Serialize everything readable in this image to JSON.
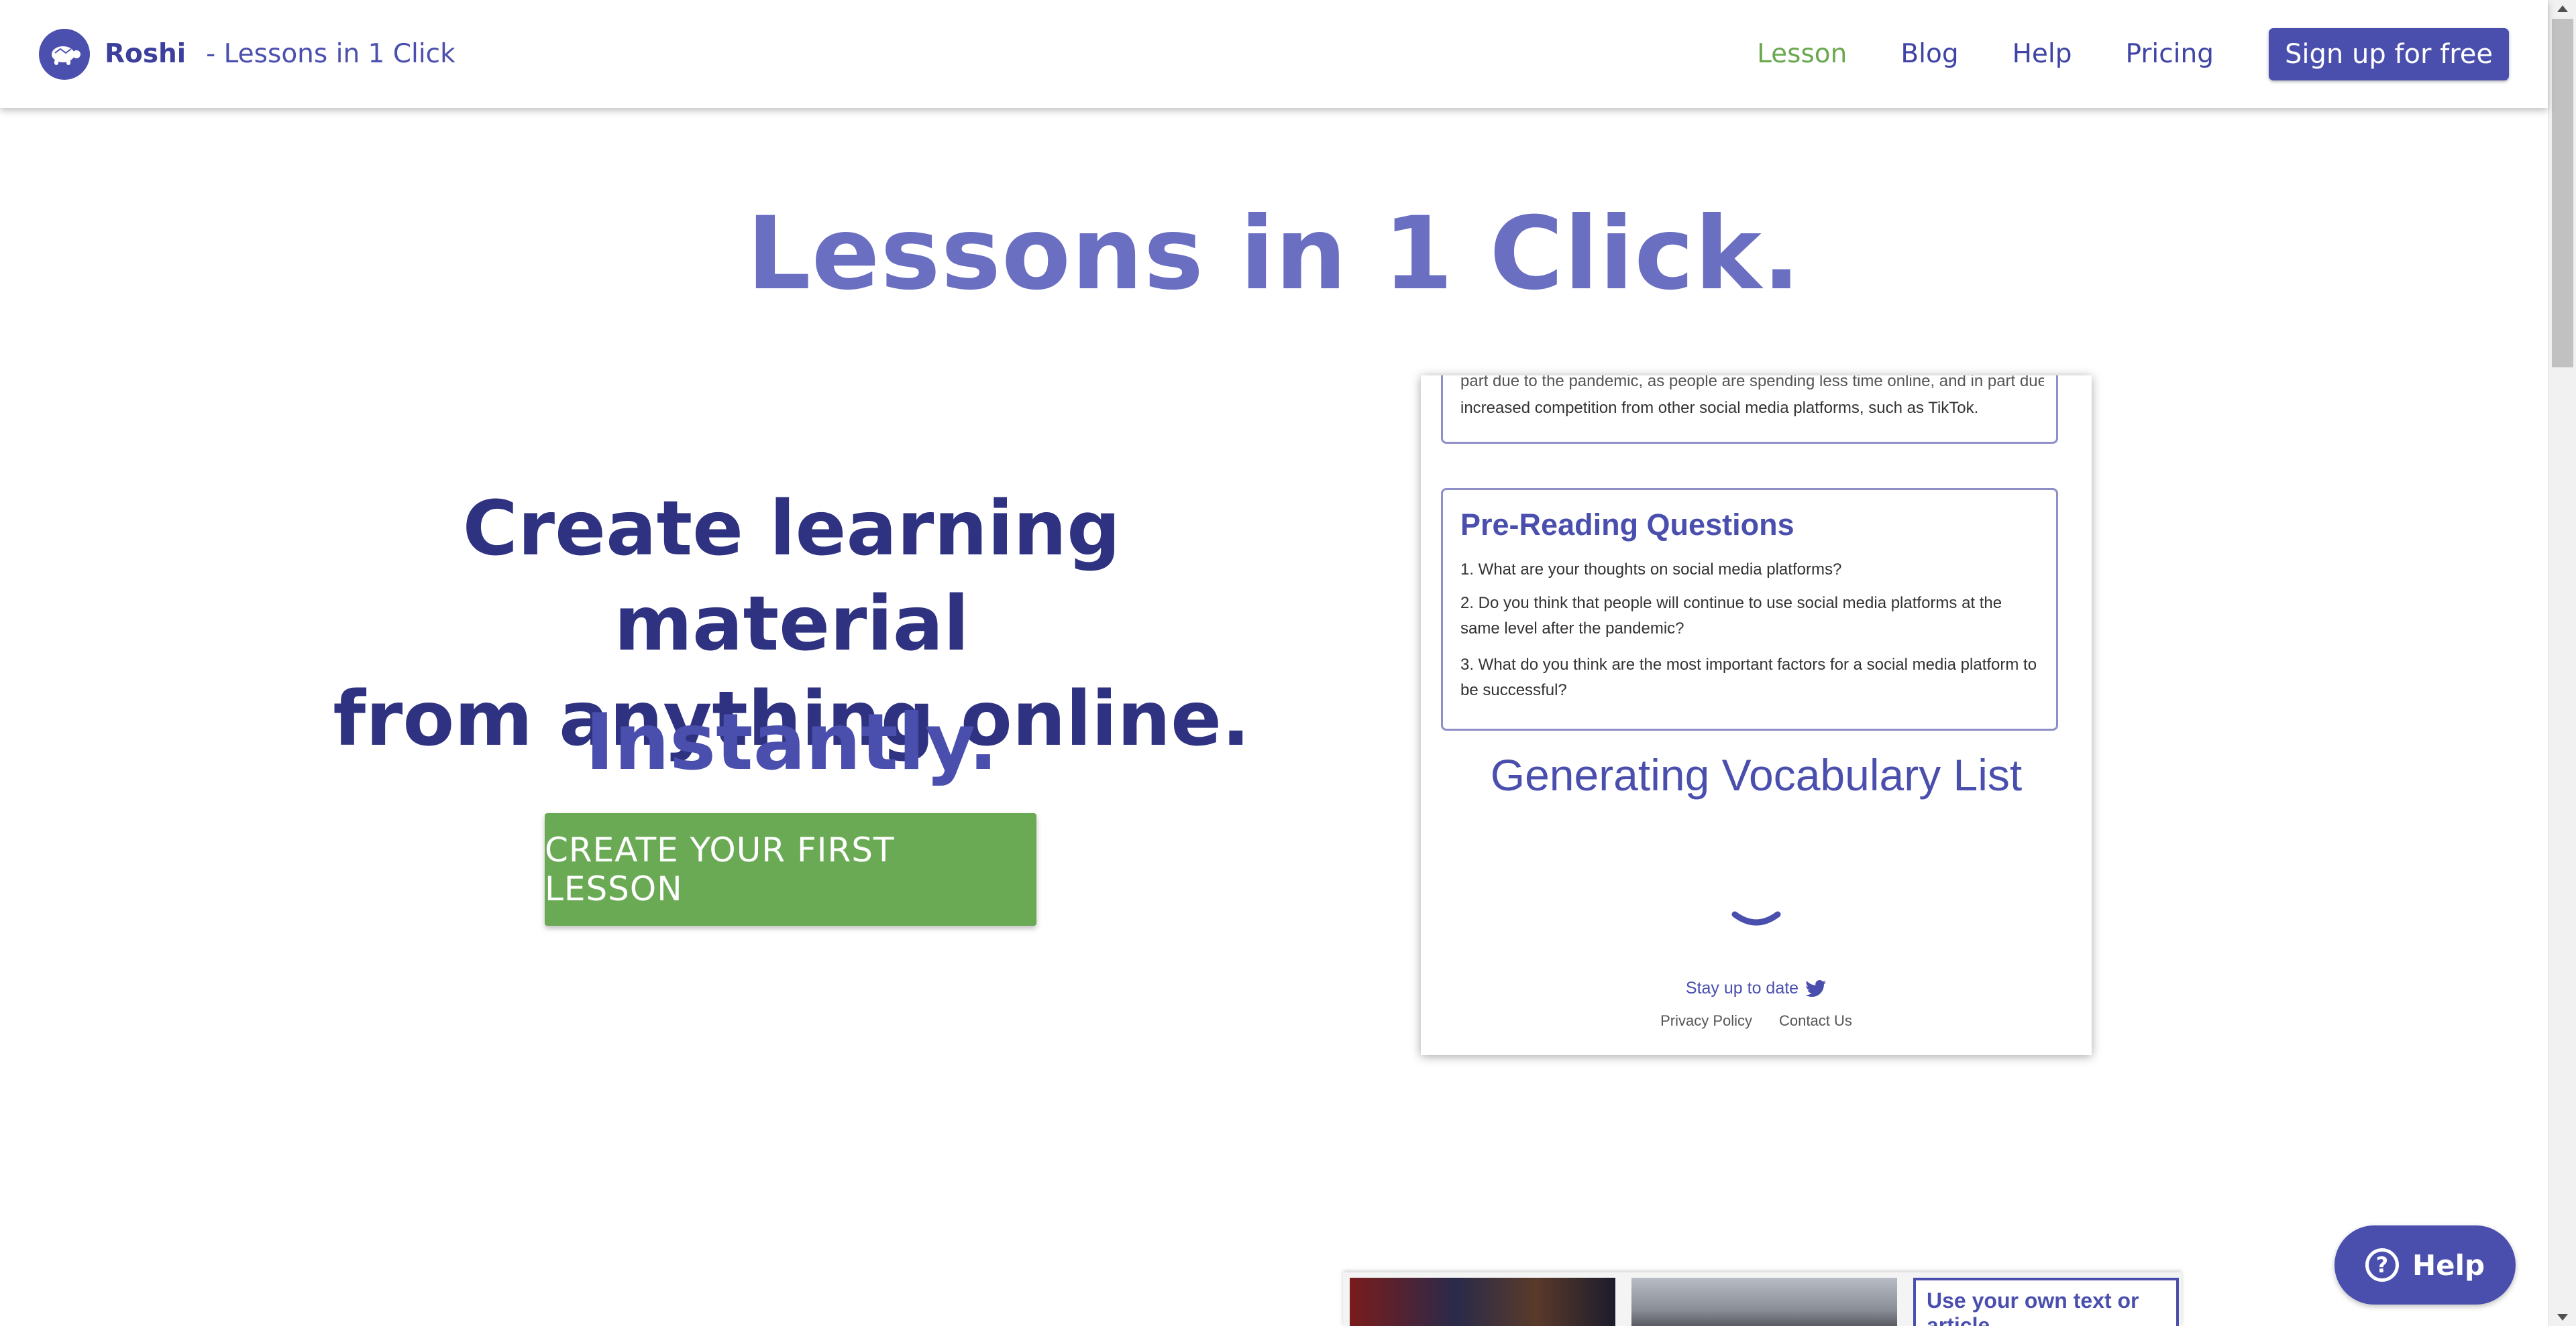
{
  "navbar": {
    "brand_name": "Roshi",
    "brand_tagline": "- Lessons in 1 Click",
    "links": [
      {
        "label": "Lesson",
        "active": true
      },
      {
        "label": "Blog",
        "active": false
      },
      {
        "label": "Help",
        "active": false
      },
      {
        "label": "Pricing",
        "active": false
      }
    ],
    "signup_label": "Sign up for free"
  },
  "hero": {
    "title": "Lessons in 1 Click.",
    "headline_line1": "Create learning material",
    "headline_line2": "from anything online.",
    "instantly": "Instantly.",
    "cta_label": "CREATE YOUR FIRST LESSON"
  },
  "preview": {
    "cut_text": "part due to the pandemic, as people are spending less time online, and in part due to",
    "top_text": "increased competition from other social media platforms, such as TikTok.",
    "questions_title": "Pre-Reading Questions",
    "questions": [
      "1. What are your thoughts on social media platforms?",
      "2. Do you think that people will continue to use social media platforms at the same level after the pandemic?",
      "3. What do you think are the most important factors for a social media platform to be successful?"
    ],
    "generating_title": "Generating Vocabulary List",
    "stay_up_to_date": "Stay up to date",
    "privacy_policy": "Privacy Policy",
    "contact_us": "Contact Us"
  },
  "help_button": {
    "label": "Help"
  },
  "bottom_strip": {
    "own_text_label": "Use your own text or article"
  },
  "colors": {
    "accent": "#4a4fae",
    "active_link": "#6aa84f",
    "cta": "#6aaa55",
    "hero_title": "#6a6fc1",
    "headline": "#2e3280"
  }
}
